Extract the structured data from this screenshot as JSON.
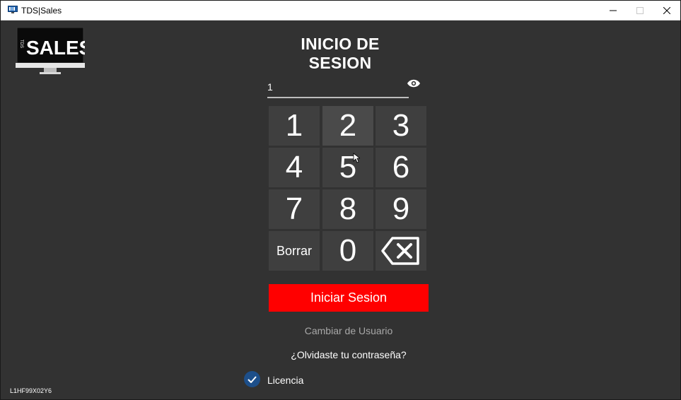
{
  "window": {
    "title": "TDS|Sales",
    "app_icon": "app-monitor-icon",
    "controls": [
      "minimize-icon",
      "maximize-icon",
      "close-icon"
    ]
  },
  "logo": {
    "brand": "SALES",
    "vertical_letters": "TDS"
  },
  "heading": "INICIO DE SESION",
  "password": {
    "value": "1",
    "reveal_icon": "eye-icon"
  },
  "keypad": {
    "keys": [
      "1",
      "2",
      "3",
      "4",
      "5",
      "6",
      "7",
      "8",
      "9",
      "Borrar",
      "0"
    ],
    "backspace_icon": "backspace-icon",
    "hovered_key": "2"
  },
  "signin_label": "Iniciar Sesion",
  "switch_user_label": "Cambiar de Usuario",
  "forgot_label": "¿Olvidaste tu contraseña?",
  "license": {
    "label": "Licencia",
    "checked": true
  },
  "device_code": "L1HF99X02Y6",
  "colors": {
    "background": "#323232",
    "key_background": "#3f3f3f",
    "key_hover": "#4a4a4a",
    "accent_red": "#ff0000",
    "checkbox_blue": "#1d4f8a",
    "muted_text": "#a8a8a8"
  }
}
